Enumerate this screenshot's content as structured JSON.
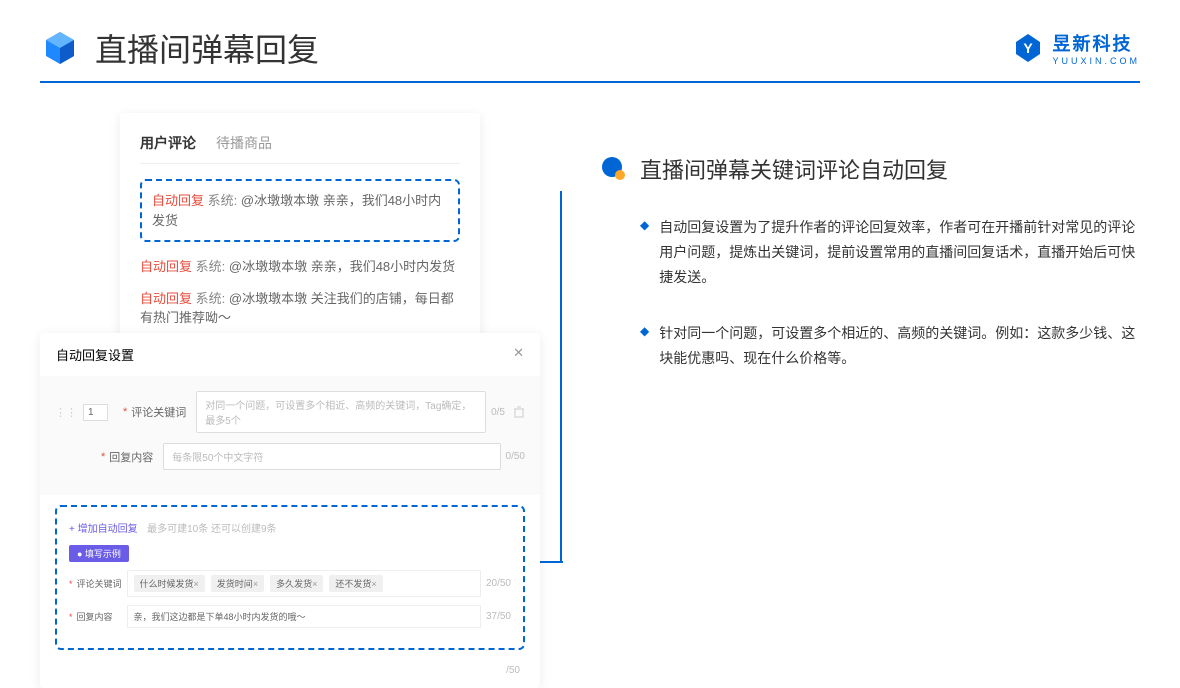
{
  "header": {
    "title": "直播间弹幕回复"
  },
  "logo": {
    "main": "昱新科技",
    "sub": "YUUXIN.COM"
  },
  "card1": {
    "tab_active": "用户评论",
    "tab_inactive": "待播商品",
    "highlighted_comment": {
      "badge": "自动回复",
      "sys": "系统:",
      "text": "@冰墩墩本墩 亲亲，我们48小时内发货"
    },
    "comments": [
      {
        "badge": "自动回复",
        "sys": "系统:",
        "text": "@冰墩墩本墩 亲亲，我们48小时内发货"
      },
      {
        "badge": "自动回复",
        "sys": "系统:",
        "text": "@冰墩墩本墩 关注我们的店铺，每日都有热门推荐呦～"
      }
    ]
  },
  "card2": {
    "title": "自动回复设置",
    "num": "1",
    "row1_label": "评论关键词",
    "row1_placeholder": "对同一个问题，可设置多个相近、高频的关键词，Tag确定，最多5个",
    "row1_count": "0/5",
    "row2_label": "回复内容",
    "row2_placeholder": "每条限50个中文字符",
    "row2_count": "0/50",
    "add_link": "+ 增加自动回复",
    "add_hint": "最多可建10条 还可以创建9条",
    "example_badge": "● 填写示例",
    "ex_row1_label": "评论关键词",
    "ex_tags": [
      "什么时候发货",
      "发货时间",
      "多久发货",
      "还不发货"
    ],
    "ex_row1_count": "20/50",
    "ex_row2_label": "回复内容",
    "ex_row2_text": "亲，我们这边都是下单48小时内发货的哦～",
    "ex_row2_count": "37/50",
    "extra_count": "/50"
  },
  "right": {
    "title": "直播间弹幕关键词评论自动回复",
    "bullets": [
      "自动回复设置为了提升作者的评论回复效率，作者可在开播前针对常见的评论用户问题，提炼出关键词，提前设置常用的直播间回复话术，直播开始后可快捷发送。",
      "针对同一个问题，可设置多个相近的、高频的关键词。例如：这款多少钱、这块能优惠吗、现在什么价格等。"
    ]
  }
}
